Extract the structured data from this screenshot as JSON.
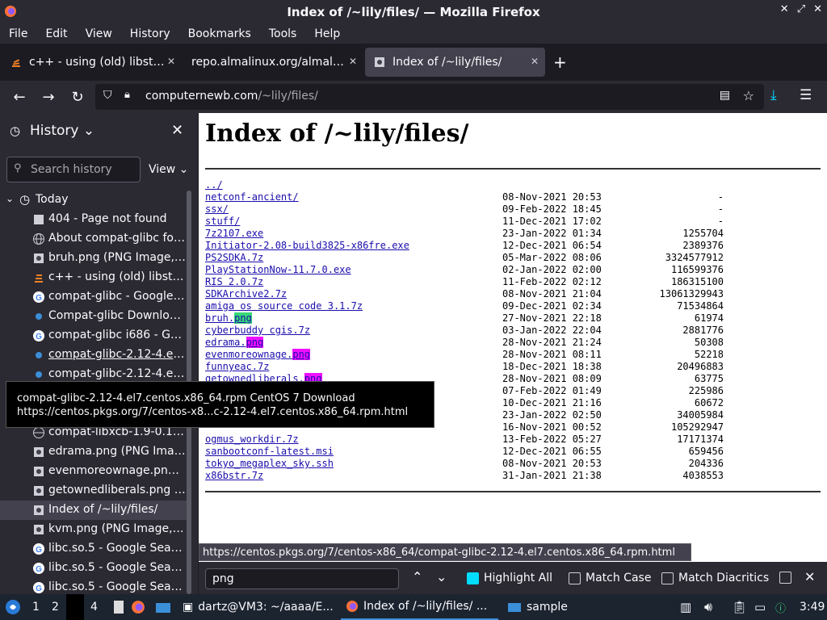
{
  "window": {
    "title": "Index of /~lily/files/ — Mozilla Firefox"
  },
  "menu": [
    "File",
    "Edit",
    "View",
    "History",
    "Bookmarks",
    "Tools",
    "Help"
  ],
  "tabs": [
    {
      "label": "c++ - using (old) libstdc++"
    },
    {
      "label": "repo.almalinux.org/almalinux"
    },
    {
      "label": "Index of /~lily/files/"
    }
  ],
  "url": {
    "host": "computernewb.com",
    "path": "/~lily/files/"
  },
  "sidebar": {
    "title": "History",
    "search_placeholder": "Search history",
    "view_label": "View",
    "group": "Today",
    "items": [
      {
        "label": "404 - Page not found",
        "icon": "page-icon"
      },
      {
        "label": "About compat-glibc for ...",
        "icon": "globe-icon"
      },
      {
        "label": "bruh.png (PNG Image, 8...",
        "icon": "image-icon"
      },
      {
        "label": "c++ - using (old) libstdc...",
        "icon": "stackoverflow-icon"
      },
      {
        "label": "compat-glibc - Google S...",
        "icon": "google-icon"
      },
      {
        "label": "Compat-glibc Download ...",
        "icon": "pkg-icon"
      },
      {
        "label": "compat-glibc i686 - Goo...",
        "icon": "google-icon"
      },
      {
        "label": "compat-glibc-2.12-4.el7...",
        "icon": "pkg-icon"
      },
      {
        "label": "compat-glibc-2.12-4.el7...",
        "icon": "pkg-icon"
      },
      {
        "label": "",
        "icon": ""
      },
      {
        "label": "",
        "icon": ""
      },
      {
        "label": "compat-libxcb-1.9-0.1.el...",
        "icon": "globe-icon"
      },
      {
        "label": "edrama.png (PNG Imag...",
        "icon": "image-icon"
      },
      {
        "label": "evenmoreownage.png (...",
        "icon": "image-icon"
      },
      {
        "label": "getownedliberals.png (P...",
        "icon": "image-icon"
      },
      {
        "label": "Index of /~lily/files/",
        "icon": "image-icon"
      },
      {
        "label": "kvm.png (PNG Image, 1...",
        "icon": "image-icon"
      },
      {
        "label": "libc.so.5 - Google Search",
        "icon": "google-icon"
      },
      {
        "label": "libc.so.5 - Google Search",
        "icon": "google-icon"
      },
      {
        "label": "libc.so.5 - Google Search",
        "icon": "google-icon"
      }
    ]
  },
  "page": {
    "heading": "Index of /~lily/files/",
    "rows": [
      {
        "name": "../",
        "date": "",
        "size": ""
      },
      {
        "name": "netconf-ancient/",
        "date": "08-Nov-2021 20:53",
        "size": "-"
      },
      {
        "name": "ssx/",
        "date": "09-Feb-2022 18:45",
        "size": "-"
      },
      {
        "name": "stuff/",
        "date": "11-Dec-2021 17:02",
        "size": "-"
      },
      {
        "name": "7z2107.exe",
        "date": "23-Jan-2022 01:34",
        "size": "1255704"
      },
      {
        "name": "Initiator-2.08-build3825-x86fre.exe",
        "date": "12-Dec-2021 06:54",
        "size": "2389376"
      },
      {
        "name": "PS2SDKA.7z",
        "date": "05-Mar-2022 08:06",
        "size": "3324577912"
      },
      {
        "name": "PlayStationNow-11.7.0.exe",
        "date": "02-Jan-2022 02:00",
        "size": "116599376"
      },
      {
        "name": "RIS 2.0.7z",
        "date": "11-Feb-2022 02:12",
        "size": "186315100"
      },
      {
        "name": "SDKArchive2.7z",
        "date": "08-Nov-2021 21:04",
        "size": "13061329943"
      },
      {
        "name": "amiga os source code 3.1.7z",
        "date": "09-Dec-2021 02:34",
        "size": "71534864"
      },
      {
        "name_pre": "bruh.",
        "name_hl": "png",
        "hl": "g",
        "date": "27-Nov-2021 22:18",
        "size": "61974"
      },
      {
        "name": "cyberbuddy cgis.7z",
        "date": "03-Jan-2022 22:04",
        "size": "2881776"
      },
      {
        "name_pre": "edrama.",
        "name_hl": "png",
        "hl": "m",
        "date": "28-Nov-2021 21:24",
        "size": "50308"
      },
      {
        "name_pre": "evenmoreownage.",
        "name_hl": "png",
        "hl": "m",
        "date": "28-Nov-2021 08:11",
        "size": "52218"
      },
      {
        "name": "funnyeac.7z",
        "date": "18-Dec-2021 18:38",
        "size": "20496883"
      },
      {
        "name_pre": "getownedliberals.",
        "name_hl": "png",
        "hl": "m",
        "date": "28-Nov-2021 08:09",
        "size": "63775"
      },
      {
        "name": "",
        "date": "07-Feb-2022 01:49",
        "size": "225986"
      },
      {
        "name": "",
        "date": "10-Dec-2021 21:16",
        "size": "60672"
      },
      {
        "name": "",
        "date": "23-Jan-2022 02:50",
        "size": "34005984"
      },
      {
        "name": "",
        "date": "16-Nov-2021 00:52",
        "size": "105292947"
      },
      {
        "name": "ogmus_workdir.7z",
        "date": "13-Feb-2022 05:27",
        "size": "17171374"
      },
      {
        "name": "sanbootconf-latest.msi",
        "date": "12-Dec-2021 06:55",
        "size": "659456"
      },
      {
        "name": "tokyo_megaplex_sky.ssh",
        "date": "08-Nov-2021 20:53",
        "size": "204336"
      },
      {
        "name": "x86bstr.7z",
        "date": "31-Jan-2021 21:38",
        "size": "4038553"
      }
    ]
  },
  "tooltip": {
    "line1": "compat-glibc-2.12-4.el7.centos.x86_64.rpm CentOS 7 Download",
    "line2": "https://centos.pkgs.org/7/centos-x8...c-2.12-4.el7.centos.x86_64.rpm.html"
  },
  "status_url": "https://centos.pkgs.org/7/centos-x86_64/compat-glibc-2.12-4.el7.centos.x86_64.rpm.html",
  "findbar": {
    "query": "png",
    "highlight_all": "Highlight All",
    "match_case": "Match Case",
    "match_diacritics": "Match Diacritics"
  },
  "taskbar": {
    "workspaces": [
      "1",
      "2",
      "",
      "4"
    ],
    "terminal": "dartz@VM3: ~/aaaa/E...",
    "firefox": "Index of /~lily/files/ ...",
    "folder": "sample",
    "clock": "3:49"
  }
}
